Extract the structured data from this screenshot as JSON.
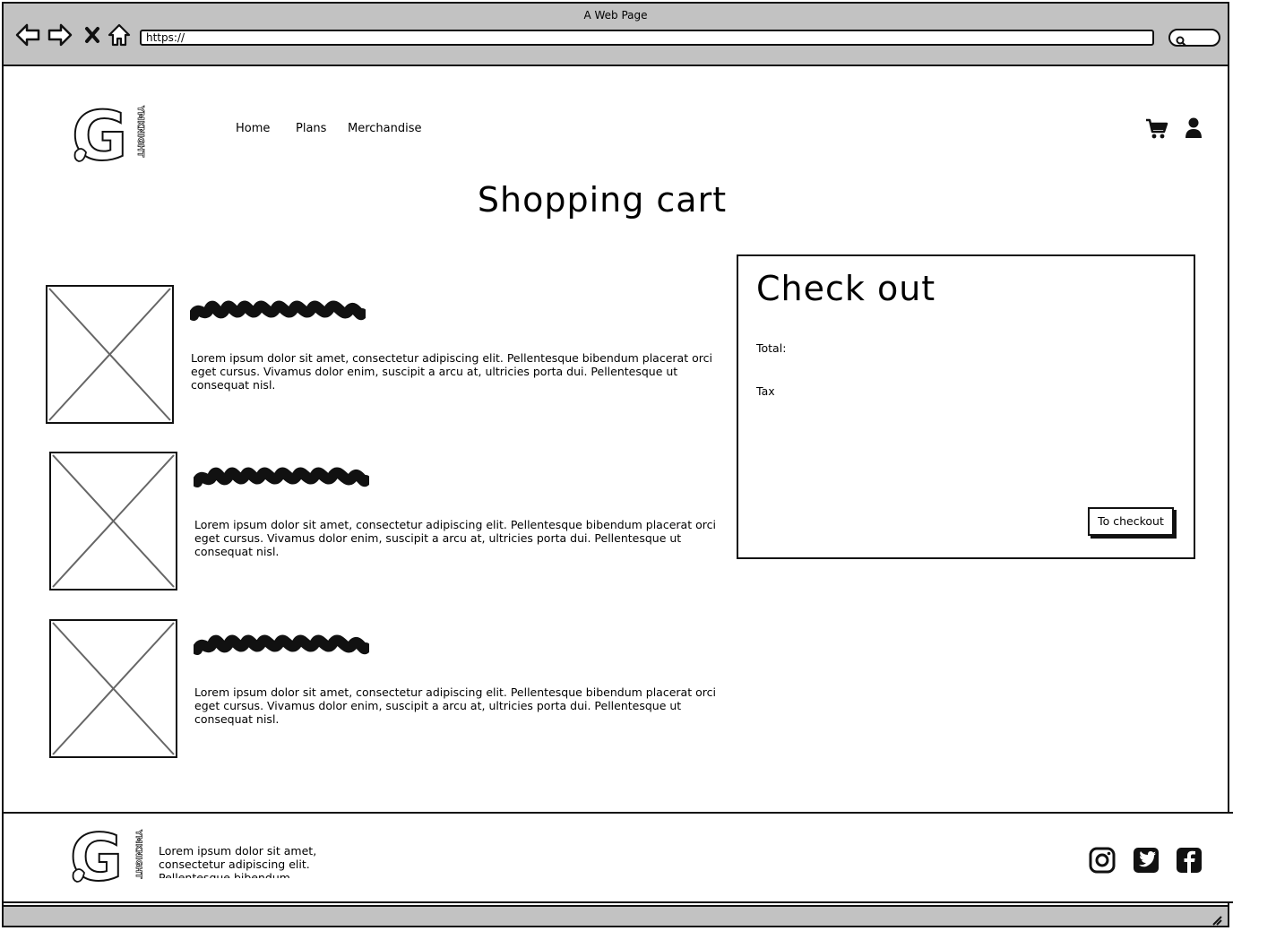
{
  "window": {
    "title": "A Web Page"
  },
  "browser": {
    "url": "https://"
  },
  "nav": {
    "items": [
      "Home",
      "Plans",
      "Merchandise"
    ]
  },
  "logo": {
    "letter": "G",
    "vertical_text": "YMKNIGHT"
  },
  "page": {
    "title": "Shopping cart"
  },
  "cart_items": [
    {
      "description": "Lorem ipsum dolor sit amet, consectetur adipiscing elit. Pellentesque bibendum placerat orci eget cursus. Vivamus dolor enim, suscipit a arcu at, ultricies porta dui. Pellentesque ut consequat nisl."
    },
    {
      "description": "Lorem ipsum dolor sit amet, consectetur adipiscing elit. Pellentesque bibendum placerat orci eget cursus. Vivamus dolor enim, suscipit a arcu at, ultricies porta dui. Pellentesque ut consequat nisl."
    },
    {
      "description": "Lorem ipsum dolor sit amet, consectetur adipiscing elit. Pellentesque bibendum placerat orci eget cursus. Vivamus dolor enim, suscipit a arcu at, ultricies porta dui. Pellentesque ut consequat nisl."
    }
  ],
  "checkout": {
    "title": "Check out",
    "total_label": "Total:",
    "tax_label": "Tax",
    "button_label": "To checkout"
  },
  "footer": {
    "text": "Lorem ipsum dolor sit amet, consectetur adipiscing elit. Pellentesque bibendum"
  },
  "icons": {
    "back": "back-arrow-icon",
    "forward": "forward-arrow-icon",
    "stop": "close-icon",
    "home": "home-icon",
    "search": "search-icon",
    "cart": "shopping-cart-icon",
    "user": "user-icon",
    "instagram": "instagram-icon",
    "twitter": "twitter-icon",
    "facebook": "facebook-icon"
  }
}
